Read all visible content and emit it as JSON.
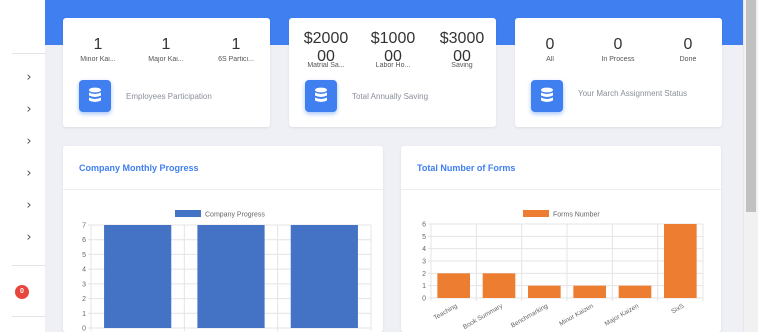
{
  "sidebar": {
    "chevron_glyph": "›",
    "badge_count": "0"
  },
  "stats": [
    {
      "values": [
        {
          "value": "1",
          "label": "Minor Kai..."
        },
        {
          "value": "1",
          "label": "Major Kai..."
        },
        {
          "value": "1",
          "label": "6S Partici..."
        }
      ],
      "icon": "database-icon",
      "description": "Employees Participation"
    },
    {
      "values": [
        {
          "value": "$2000\n00",
          "label": "Matrial Sa..."
        },
        {
          "value": "$1000\n00",
          "label": "Labor Ho..."
        },
        {
          "value": "$3000\n00",
          "label": "Saving"
        }
      ],
      "icon": "database-icon",
      "description": "Total Annually Saving"
    },
    {
      "values": [
        {
          "value": "0",
          "label": "All"
        },
        {
          "value": "0",
          "label": "In Process"
        },
        {
          "value": "0",
          "label": "Done"
        }
      ],
      "icon": "database-icon",
      "description": "Your March Assignment Status"
    }
  ],
  "charts": {
    "progress": {
      "title": "Company Monthly Progress"
    },
    "forms": {
      "title": "Total Number of Forms"
    }
  },
  "chart_data": [
    {
      "type": "bar",
      "categories": [
        "",
        "",
        ""
      ],
      "series": [
        {
          "name": "Company Progress",
          "values": [
            7,
            7,
            7
          ]
        }
      ],
      "y_ticks": [
        "0",
        "1",
        "2",
        "3",
        "4",
        "5",
        "6",
        "7"
      ],
      "ylim": [
        0,
        7
      ],
      "color": "#4472c4",
      "legend": "top-center",
      "grid": true
    },
    {
      "type": "bar",
      "categories": [
        "Teaching",
        "Book Summary",
        "Benchmarking",
        "Minor Kaizen",
        "Major Kaizen",
        "SixS"
      ],
      "series": [
        {
          "name": "Forms Number",
          "values": [
            2,
            2,
            1,
            1,
            1,
            6
          ]
        }
      ],
      "y_ticks": [
        "0",
        "1",
        "2",
        "3",
        "4",
        "5",
        "6"
      ],
      "ylim": [
        0,
        6
      ],
      "color": "#ed7d31",
      "legend": "top-center",
      "grid": true
    }
  ]
}
